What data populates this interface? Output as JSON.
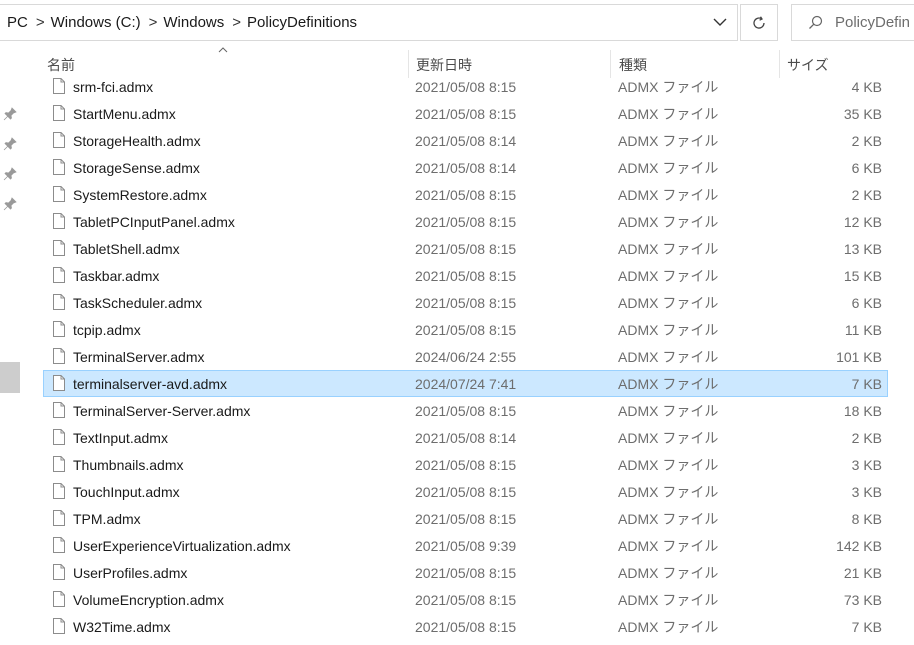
{
  "address": {
    "breadcrumbs": [
      "PC",
      "Windows (C:)",
      "Windows",
      "PolicyDefinitions"
    ],
    "separator": ">"
  },
  "search": {
    "placeholder": "PolicyDefin"
  },
  "columns": {
    "name": "名前",
    "date": "更新日時",
    "type": "種類",
    "size": "サイズ"
  },
  "files": [
    {
      "name": "srm-fci.admx",
      "date": "2021/05/08 8:15",
      "type": "ADMX ファイル",
      "size": "4 KB"
    },
    {
      "name": "StartMenu.admx",
      "date": "2021/05/08 8:15",
      "type": "ADMX ファイル",
      "size": "35 KB"
    },
    {
      "name": "StorageHealth.admx",
      "date": "2021/05/08 8:14",
      "type": "ADMX ファイル",
      "size": "2 KB"
    },
    {
      "name": "StorageSense.admx",
      "date": "2021/05/08 8:14",
      "type": "ADMX ファイル",
      "size": "6 KB"
    },
    {
      "name": "SystemRestore.admx",
      "date": "2021/05/08 8:15",
      "type": "ADMX ファイル",
      "size": "2 KB"
    },
    {
      "name": "TabletPCInputPanel.admx",
      "date": "2021/05/08 8:15",
      "type": "ADMX ファイル",
      "size": "12 KB"
    },
    {
      "name": "TabletShell.admx",
      "date": "2021/05/08 8:15",
      "type": "ADMX ファイル",
      "size": "13 KB"
    },
    {
      "name": "Taskbar.admx",
      "date": "2021/05/08 8:15",
      "type": "ADMX ファイル",
      "size": "15 KB"
    },
    {
      "name": "TaskScheduler.admx",
      "date": "2021/05/08 8:15",
      "type": "ADMX ファイル",
      "size": "6 KB"
    },
    {
      "name": "tcpip.admx",
      "date": "2021/05/08 8:15",
      "type": "ADMX ファイル",
      "size": "11 KB"
    },
    {
      "name": "TerminalServer.admx",
      "date": "2024/06/24 2:55",
      "type": "ADMX ファイル",
      "size": "101 KB"
    },
    {
      "name": "terminalserver-avd.admx",
      "date": "2024/07/24 7:41",
      "type": "ADMX ファイル",
      "size": "7 KB",
      "selected": true
    },
    {
      "name": "TerminalServer-Server.admx",
      "date": "2021/05/08 8:15",
      "type": "ADMX ファイル",
      "size": "18 KB"
    },
    {
      "name": "TextInput.admx",
      "date": "2021/05/08 8:14",
      "type": "ADMX ファイル",
      "size": "2 KB"
    },
    {
      "name": "Thumbnails.admx",
      "date": "2021/05/08 8:15",
      "type": "ADMX ファイル",
      "size": "3 KB"
    },
    {
      "name": "TouchInput.admx",
      "date": "2021/05/08 8:15",
      "type": "ADMX ファイル",
      "size": "3 KB"
    },
    {
      "name": "TPM.admx",
      "date": "2021/05/08 8:15",
      "type": "ADMX ファイル",
      "size": "8 KB"
    },
    {
      "name": "UserExperienceVirtualization.admx",
      "date": "2021/05/08 9:39",
      "type": "ADMX ファイル",
      "size": "142 KB"
    },
    {
      "name": "UserProfiles.admx",
      "date": "2021/05/08 8:15",
      "type": "ADMX ファイル",
      "size": "21 KB"
    },
    {
      "name": "VolumeEncryption.admx",
      "date": "2021/05/08 8:15",
      "type": "ADMX ファイル",
      "size": "73 KB"
    },
    {
      "name": "W32Time.admx",
      "date": "2021/05/08 8:15",
      "type": "ADMX ファイル",
      "size": "7 KB"
    }
  ]
}
